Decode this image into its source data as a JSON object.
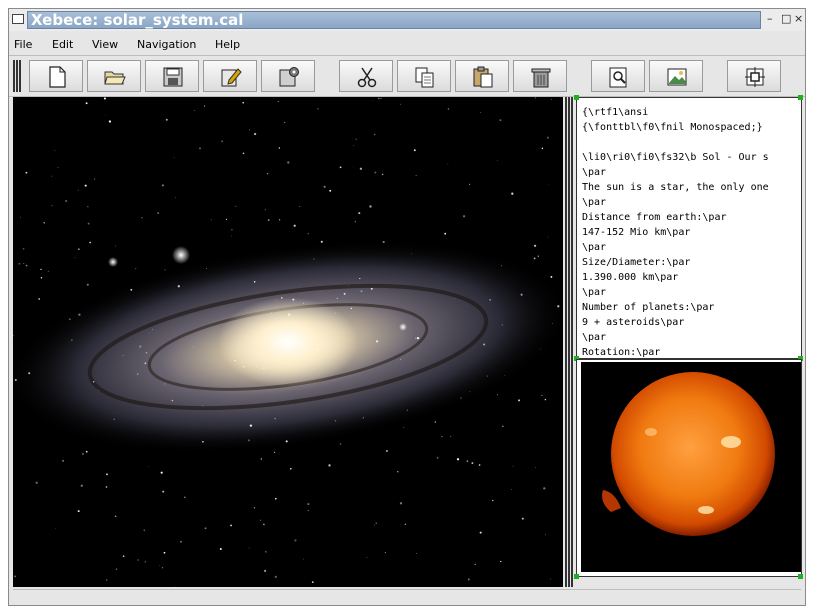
{
  "window": {
    "title": "Xebece: solar_system.cal",
    "controls": [
      "–",
      "□",
      "×"
    ]
  },
  "menubar": {
    "items": [
      {
        "label": "File"
      },
      {
        "label": "Edit"
      },
      {
        "label": "View"
      },
      {
        "label": "Navigation"
      },
      {
        "label": "Help"
      }
    ]
  },
  "toolbar": {
    "buttons": [
      {
        "icon": "new-document-icon"
      },
      {
        "icon": "open-folder-icon"
      },
      {
        "icon": "save-icon"
      },
      {
        "icon": "edit-icon"
      },
      {
        "icon": "settings-icon"
      },
      {
        "icon": "cut-icon"
      },
      {
        "icon": "copy-icon"
      },
      {
        "icon": "paste-icon"
      },
      {
        "icon": "delete-icon"
      },
      {
        "icon": "zoom-icon"
      },
      {
        "icon": "image-icon"
      },
      {
        "icon": "fullscreen-icon"
      }
    ]
  },
  "text_node": {
    "lines": [
      "{\\rtf1\\ansi",
      "{\\fonttbl\\f0\\fnil Monospaced;}",
      "",
      "\\li0\\ri0\\fi0\\fs32\\b Sol - Our s",
      "\\par",
      "The sun is a star, the only one",
      "\\par",
      "Distance from earth:\\par",
      "147-152 Mio km\\par",
      "\\par",
      "Size/Diameter:\\par",
      "1.390.000 km\\par",
      "\\par",
      "Number of planets:\\par",
      "9 + asteroids\\par",
      "\\par",
      "Rotation:\\par"
    ]
  },
  "images": {
    "galaxy": "galaxy-image",
    "sun": "sun-image"
  },
  "colors": {
    "accent": "#1fb01f",
    "title_bar": "#9bb3cf"
  }
}
